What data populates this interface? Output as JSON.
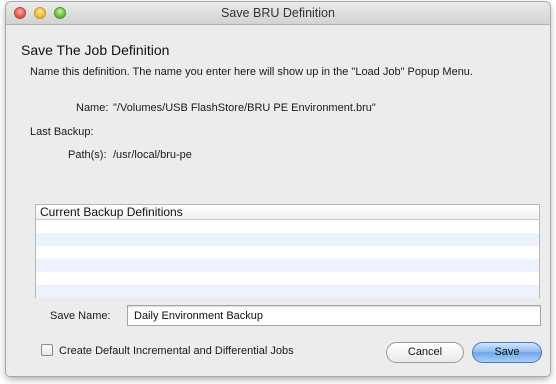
{
  "window": {
    "title": "Save BRU Definition"
  },
  "main": {
    "heading": "Save The Job Definition",
    "description": "Name this definition.  The name you enter here will show up in the \"Load Job\" Popup Menu.",
    "name_label": "Name:",
    "name_value": "\"/Volumes/USB FlashStore/BRU PE Environment.bru\"",
    "last_backup_label": "Last Backup:",
    "last_backup_value": "",
    "paths_label": "Path(s):",
    "paths_value": "/usr/local/bru-pe"
  },
  "definitions_table": {
    "header": "Current Backup Definitions",
    "rows": []
  },
  "save_name": {
    "label": "Save Name:",
    "value": "Daily Environment Backup"
  },
  "footer": {
    "checkbox_label": "Create Default Incremental and Differential Jobs",
    "checkbox_checked": false,
    "cancel_label": "Cancel",
    "save_label": "Save"
  },
  "colors": {
    "window_bg": "#ececec",
    "table_stripe": "#edf3fe",
    "default_button": "#6ea6e8"
  }
}
